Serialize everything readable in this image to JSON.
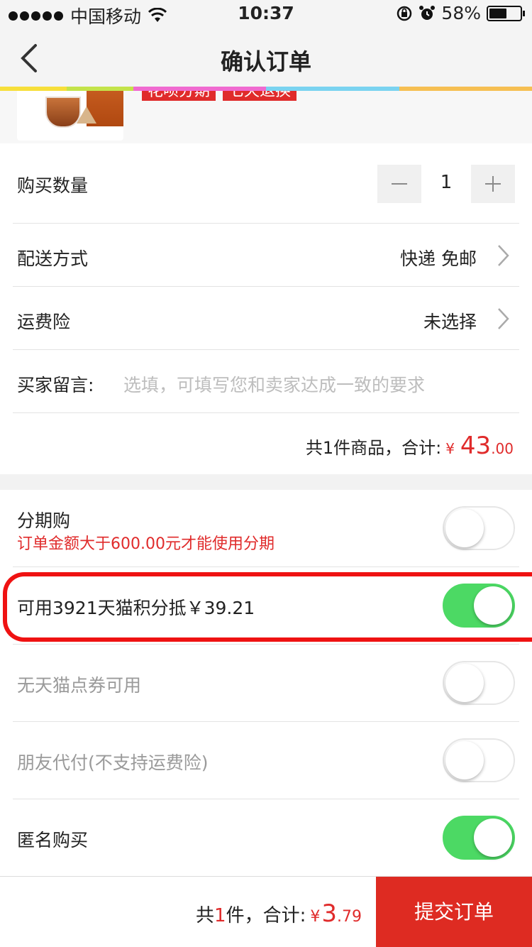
{
  "status_bar": {
    "carrier": "中国移动",
    "time": "10:37",
    "battery_percent": "58%",
    "icons": [
      "signal-dots-icon",
      "wifi-icon",
      "rotation-lock-icon",
      "alarm-icon",
      "battery-icon"
    ]
  },
  "nav": {
    "title": "确认订单",
    "back_icon": "chevron-left-icon"
  },
  "rainbow_colors": [
    "#f7df3a",
    "#c3e34a",
    "#f06ad0",
    "#f06ad0",
    "#7ad3f0",
    "#7ad3f0",
    "#f6bf52",
    "#f6bf52"
  ],
  "product": {
    "tags": [
      "花呗分期",
      "七天退换"
    ]
  },
  "order": {
    "quantity_label": "购买数量",
    "quantity_value": "1",
    "shipping_label": "配送方式",
    "shipping_value": "快递 免邮",
    "insurance_label": "运费险",
    "insurance_value": "未选择",
    "message_label": "买家留言:",
    "message_placeholder": "选填，可填写您和卖家达成一致的要求",
    "total_prefix": "共1件商品，合计:",
    "total_symbol": "¥",
    "total_int": "43",
    "total_dec": ".00"
  },
  "options": {
    "installment_label": "分期购",
    "installment_note": "订单金额大于600.00元才能使用分期",
    "installment_on": false,
    "points_label": "可用3921天猫积分抵￥39.21",
    "points_on": true,
    "coupon_label": "无天猫点券可用",
    "coupon_on": false,
    "friend_pay_label": "朋友代付(不支持运费险)",
    "friend_pay_on": false,
    "anonymous_label": "匿名购买",
    "anonymous_on": true
  },
  "footer": {
    "count_prefix": "共",
    "count_value": "1",
    "count_suffix": "件，合计:",
    "price_symbol": "¥",
    "price_int": "3",
    "price_dec": ".79",
    "submit_label": "提交订单"
  },
  "colors": {
    "accent_red": "#e02b2b",
    "toggle_green": "#4cd964",
    "submit_bg": "#de2b22"
  }
}
